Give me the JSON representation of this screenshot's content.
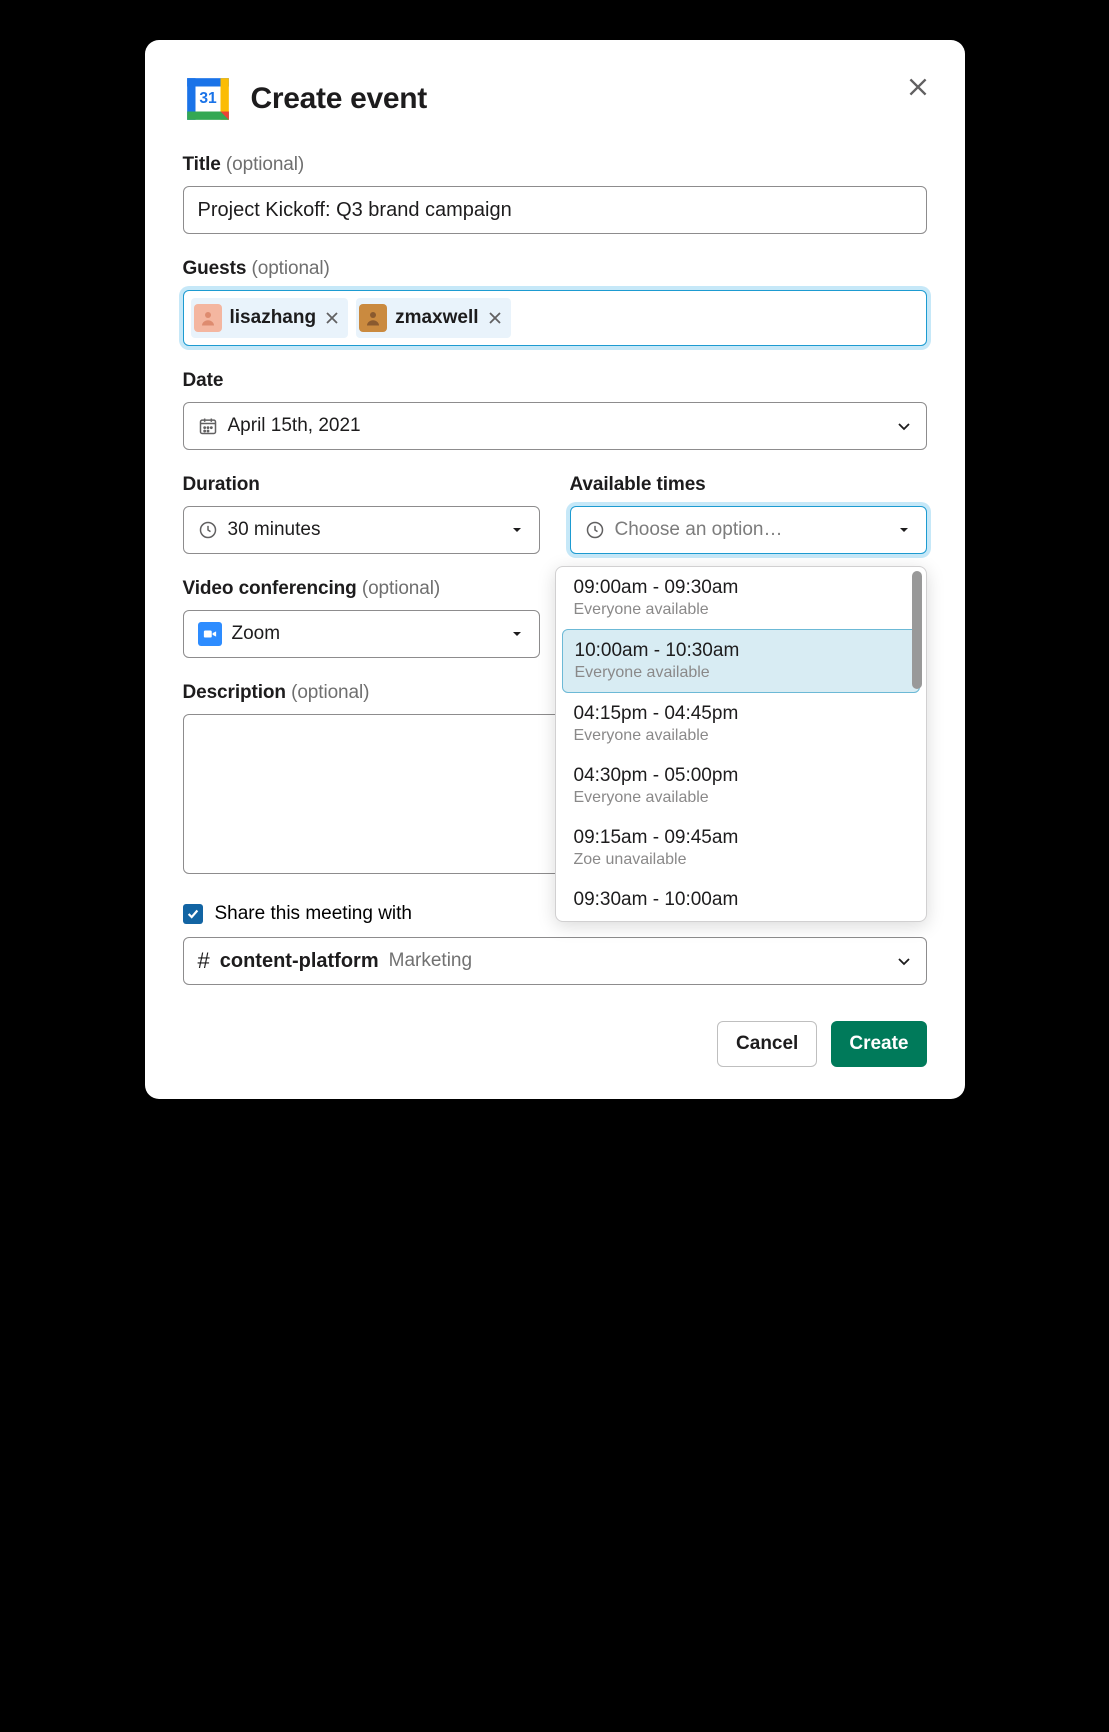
{
  "header": {
    "title": "Create event"
  },
  "title_field": {
    "label": "Title",
    "optional": "(optional)",
    "value": "Project Kickoff: Q3 brand campaign"
  },
  "guests_field": {
    "label": "Guests",
    "optional": "(optional)",
    "chips": [
      {
        "name": "lisazhang"
      },
      {
        "name": "zmaxwell"
      }
    ]
  },
  "date_field": {
    "label": "Date",
    "value": "April 15th, 2021"
  },
  "duration_field": {
    "label": "Duration",
    "value": "30 minutes"
  },
  "available_field": {
    "label": "Available times",
    "placeholder": "Choose an option…",
    "options": [
      {
        "time": "09:00am - 09:30am",
        "sub": "Everyone available",
        "selected": false
      },
      {
        "time": "10:00am - 10:30am",
        "sub": "Everyone available",
        "selected": true
      },
      {
        "time": "04:15pm - 04:45pm",
        "sub": "Everyone available",
        "selected": false
      },
      {
        "time": "04:30pm - 05:00pm",
        "sub": "Everyone available",
        "selected": false
      },
      {
        "time": "09:15am - 09:45am",
        "sub": "Zoe unavailable",
        "selected": false
      },
      {
        "time": "09:30am - 10:00am",
        "sub": "",
        "selected": false
      }
    ]
  },
  "video_field": {
    "label": "Video conferencing",
    "optional": "(optional)",
    "value": "Zoom"
  },
  "desc_field": {
    "label": "Description",
    "optional": "(optional)",
    "value": ""
  },
  "share": {
    "label": "Share this meeting with",
    "channel": "content-platform",
    "workspace": "Marketing"
  },
  "footer": {
    "cancel": "Cancel",
    "create": "Create"
  }
}
